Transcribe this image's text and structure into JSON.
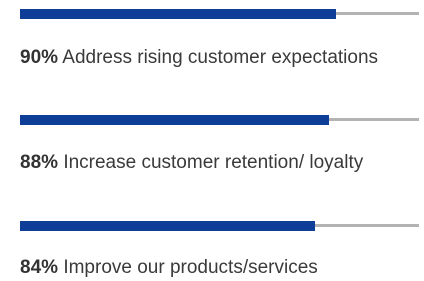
{
  "colors": {
    "bar_fill": "#0f3e99",
    "bar_track": "#b3b3b3",
    "text": "#3a3a3a"
  },
  "chart_data": {
    "type": "bar",
    "orientation": "horizontal",
    "categories": [
      "Address rising customer expectations",
      "Increase customer retention/ loyalty",
      "Improve our products/services"
    ],
    "values": [
      90,
      88,
      84
    ],
    "value_labels": [
      "90%",
      "88%",
      "84%"
    ],
    "xlim": [
      0,
      100
    ],
    "title": "",
    "xlabel": "",
    "ylabel": ""
  }
}
